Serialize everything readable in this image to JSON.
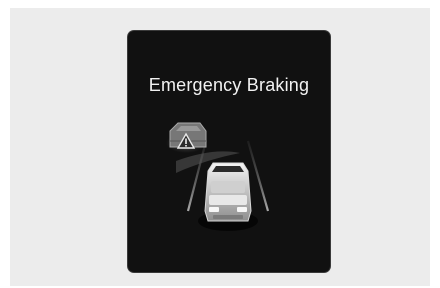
{
  "display": {
    "title": "Emergency Braking"
  },
  "icons": {
    "warning": "warning-triangle-icon",
    "vehicle_ahead": "vehicle-ahead-icon",
    "own_vehicle": "own-vehicle-icon"
  },
  "colors": {
    "page_background": "#ececec",
    "display_background": "#111111",
    "text": "#f2f2f2"
  }
}
